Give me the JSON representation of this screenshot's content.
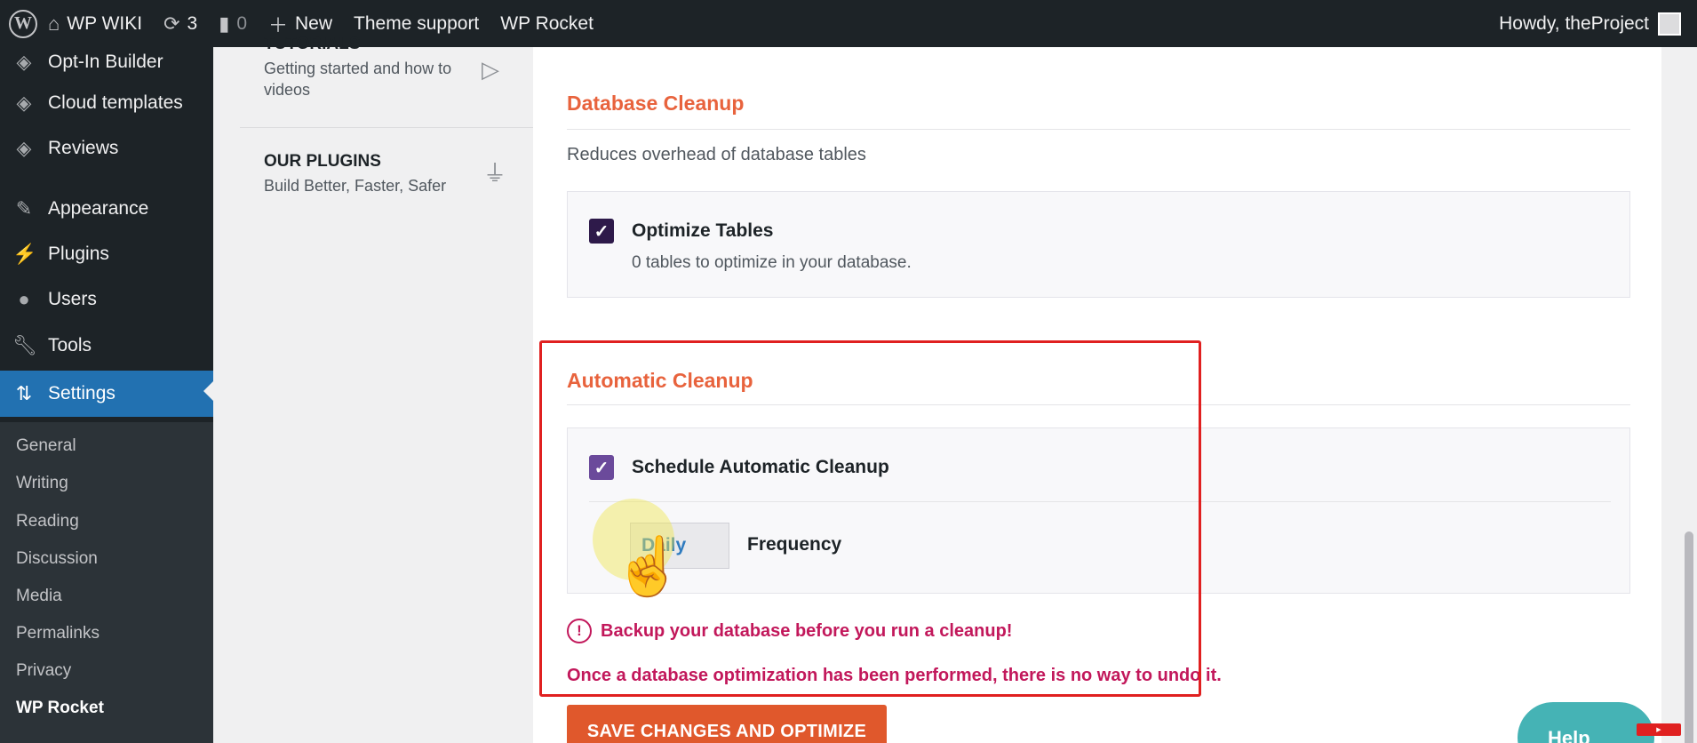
{
  "adminbar": {
    "logo_icon": "wordpress-logo-icon",
    "site_name": "WP WIKI",
    "updates_count": "3",
    "comments_count": "0",
    "new_label": "New",
    "theme_support": "Theme support",
    "wp_rocket": "WP Rocket",
    "howdy": "Howdy, theProject"
  },
  "sidebar": {
    "items": [
      {
        "label": "Opt-In Builder",
        "icon": "diamond-logo-icon"
      },
      {
        "label": "Cloud templates",
        "icon": "diamond-logo-icon"
      },
      {
        "label": "Reviews",
        "icon": "diamond-logo-icon"
      },
      {
        "label": "Appearance",
        "icon": "paintbrush-icon"
      },
      {
        "label": "Plugins",
        "icon": "plug-icon"
      },
      {
        "label": "Users",
        "icon": "user-icon"
      },
      {
        "label": "Tools",
        "icon": "wrench-icon"
      },
      {
        "label": "Settings",
        "icon": "settings-icon",
        "active": true
      }
    ],
    "submenu": [
      "General",
      "Writing",
      "Reading",
      "Discussion",
      "Media",
      "Permalinks",
      "Privacy",
      "WP Rocket"
    ]
  },
  "plugin_nav": {
    "tutorials_title": "TUTORIALS",
    "tutorials_desc": "Getting started and how to videos",
    "plugins_title": "OUR PLUGINS",
    "plugins_desc": "Build Better, Faster, Safer"
  },
  "main": {
    "db_cleanup_title": "Database Cleanup",
    "db_cleanup_desc": "Reduces overhead of database tables",
    "optimize_label": "Optimize Tables",
    "optimize_sub": "0 tables to optimize in your database.",
    "auto_cleanup_title": "Automatic Cleanup",
    "schedule_label": "Schedule Automatic Cleanup",
    "frequency_value": "Daily",
    "frequency_label": "Frequency",
    "warning_text": "Backup your database before you run a cleanup!",
    "warning_note": "Once a database optimization has been performed, there is no way to undo it.",
    "save_button": "SAVE CHANGES AND OPTIMIZE"
  },
  "help_widget": "Help",
  "colors": {
    "accent_orange": "#e8633d",
    "warning_pink": "#c2185b",
    "admin_blue": "#2271b1",
    "highlight_red": "#e02020"
  }
}
